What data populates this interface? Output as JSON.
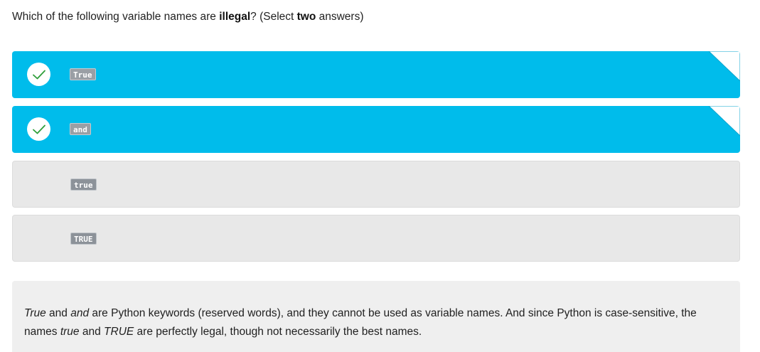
{
  "question": {
    "prefix": "Which of the following variable names are ",
    "emphasis": "illegal",
    "middle": "? (Select ",
    "count": "two",
    "suffix": " answers)"
  },
  "options": [
    {
      "label": "True",
      "selected": true,
      "check_icon": "checkmark-icon"
    },
    {
      "label": "and",
      "selected": true,
      "check_icon": "checkmark-icon"
    },
    {
      "label": "true",
      "selected": false
    },
    {
      "label": "TRUE",
      "selected": false
    }
  ],
  "feedback": {
    "kw1": "True",
    "t1": " and ",
    "kw2": "and",
    "t2": " are Python keywords (reserved words), and they cannot be used as variable names. And since Python is case-sensitive, the names ",
    "n1": "true",
    "t3": " and ",
    "n2": "TRUE",
    "t4": " are perfectly legal, though not necessarily the best names."
  },
  "colors": {
    "selected_bg": "#00bceb",
    "unselected_bg": "#e8e8e8",
    "check_green": "#2e9e3a",
    "code_tag_bg": "#8c9299",
    "feedback_bg": "#efefef"
  }
}
